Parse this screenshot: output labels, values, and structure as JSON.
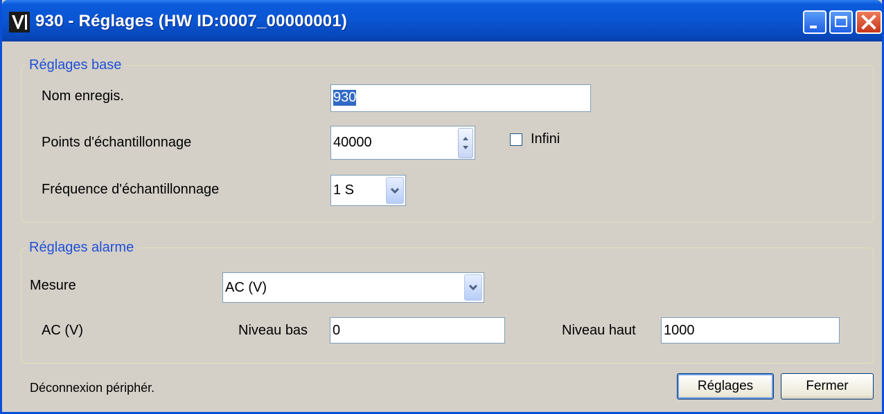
{
  "window": {
    "title": "930 - Réglages (HW ID:0007_00000001)",
    "app_icon": "V"
  },
  "base": {
    "legend": "Réglages base",
    "record_name_label": "Nom enregis.",
    "record_name_value": "930",
    "points_label": "Points d'échantillonnage",
    "points_value": "40000",
    "infinite_label": "Infini",
    "infinite_checked": false,
    "frequency_label": "Fréquence d'échantillonnage",
    "frequency_value": "1 S"
  },
  "alarm": {
    "legend": "Réglages alarme",
    "measure_label": "Mesure",
    "measure_value": "AC (V)",
    "unit_label": "AC (V)",
    "low_label": "Niveau bas",
    "low_value": "0",
    "high_label": "Niveau haut",
    "high_value": "1000"
  },
  "footer": {
    "status": "Déconnexion périphér.",
    "settings_button": "Réglages",
    "close_button": "Fermer"
  },
  "colors": {
    "titlebar": "#0a55d2",
    "legend_text": "#2050d8",
    "selection": "#316ac5"
  }
}
